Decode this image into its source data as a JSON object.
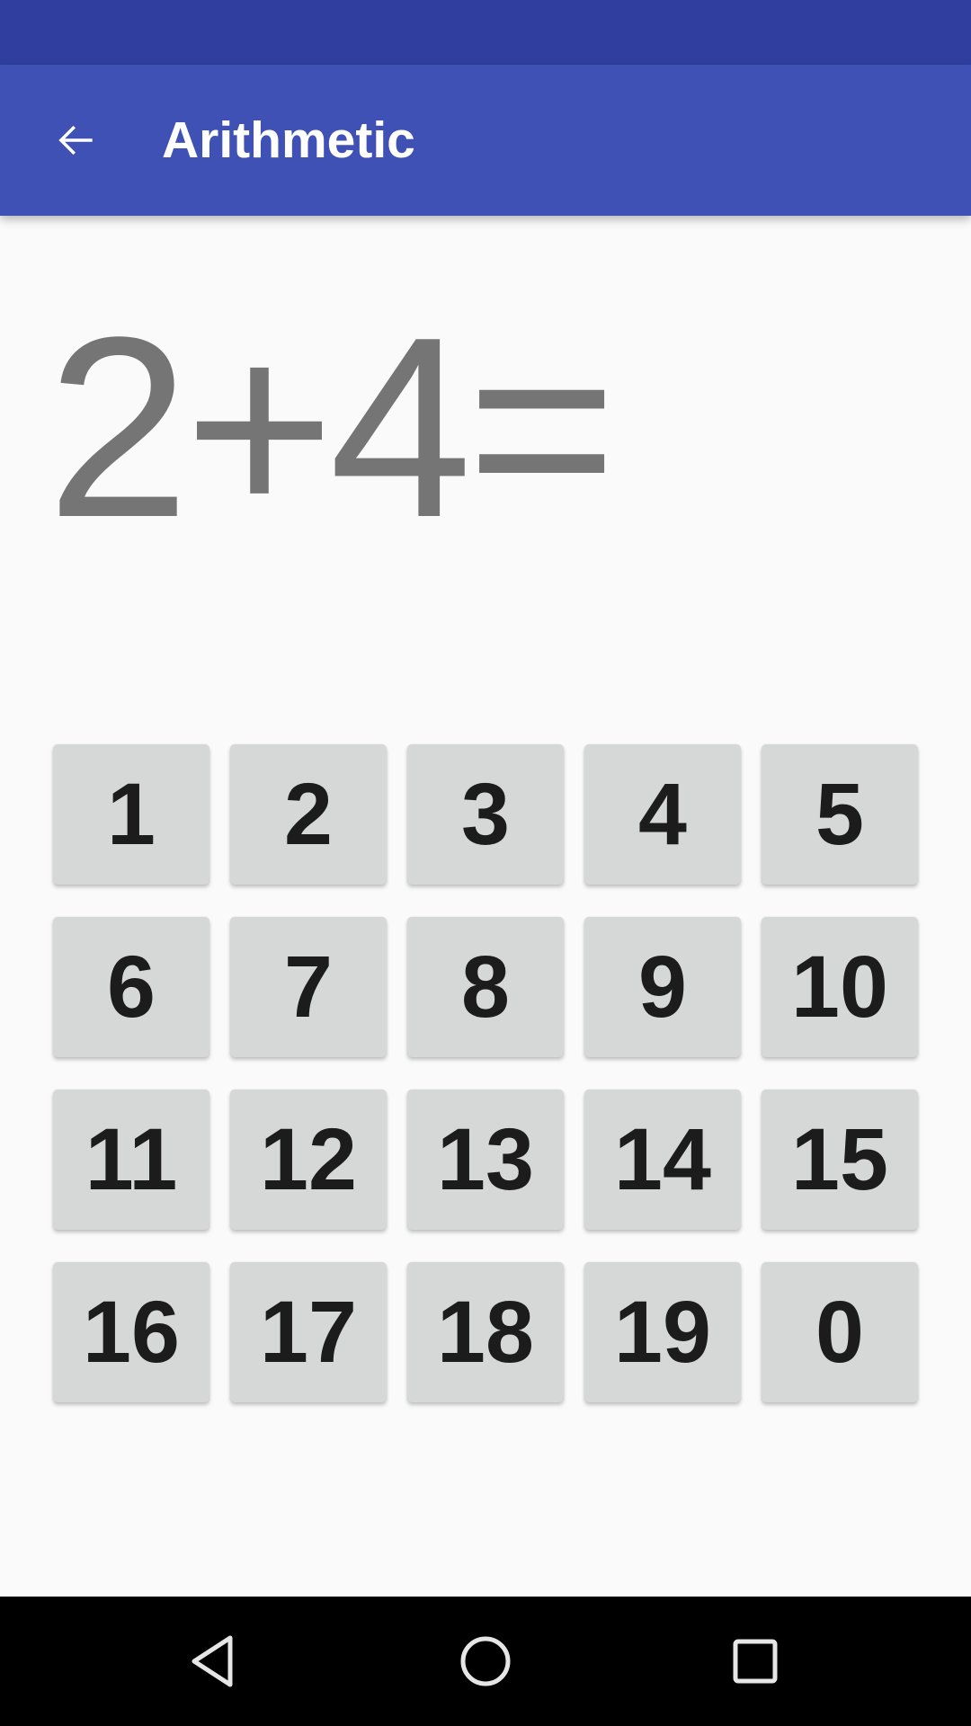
{
  "status_bar": {},
  "toolbar": {
    "title": "Arithmetic",
    "back_icon": "arrow-left-icon"
  },
  "question": {
    "text": "2+4="
  },
  "answers": [
    {
      "label": "1"
    },
    {
      "label": "2"
    },
    {
      "label": "3"
    },
    {
      "label": "4"
    },
    {
      "label": "5"
    },
    {
      "label": "6"
    },
    {
      "label": "7"
    },
    {
      "label": "8"
    },
    {
      "label": "9"
    },
    {
      "label": "10"
    },
    {
      "label": "11"
    },
    {
      "label": "12"
    },
    {
      "label": "13"
    },
    {
      "label": "14"
    },
    {
      "label": "15"
    },
    {
      "label": "16"
    },
    {
      "label": "17"
    },
    {
      "label": "18"
    },
    {
      "label": "19"
    },
    {
      "label": "0"
    }
  ],
  "navigation": {
    "back_icon": "nav-back-triangle-icon",
    "home_icon": "nav-home-circle-icon",
    "recents_icon": "nav-recents-square-icon"
  },
  "colors": {
    "primary": "#3f51b5",
    "primary_dark": "#303f9f",
    "background": "#fafafa",
    "button": "#d6d7d7",
    "question_text": "#757575",
    "button_text": "#1c1c1c"
  }
}
